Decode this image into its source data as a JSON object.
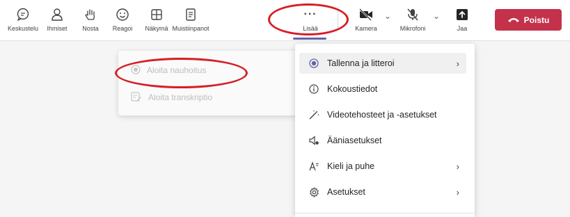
{
  "toolbar": {
    "chat_label": "Keskustelu",
    "people_label": "Ihmiset",
    "raise_label": "Nosta",
    "react_label": "Reagoi",
    "view_label": "Näkymä",
    "notes_label": "Muistiinpanot",
    "more_label": "Lisää",
    "more_glyph": "···",
    "camera_label": "Kamera",
    "mic_label": "Mikrofoni",
    "share_label": "Jaa",
    "leave_label": "Poistu",
    "leave_color": "#c4314b",
    "accent_color": "#6264a7"
  },
  "submenu": {
    "items": [
      {
        "label": "Aloita nauhoitus",
        "icon": "record-icon",
        "enabled": false
      },
      {
        "label": "Aloita transkriptio",
        "icon": "transcript-icon",
        "enabled": false
      }
    ]
  },
  "menu": {
    "items": [
      {
        "label": "Tallenna ja litteroi",
        "icon": "record-dot-icon",
        "has_submenu": true,
        "highlighted": true
      },
      {
        "label": "Kokoustiedot",
        "icon": "info-icon",
        "has_submenu": false
      },
      {
        "label": "Videotehosteet ja -asetukset",
        "icon": "magic-wand-icon",
        "has_submenu": false
      },
      {
        "label": "Ääniasetukset",
        "icon": "speaker-settings-icon",
        "has_submenu": false
      },
      {
        "label": "Kieli ja puhe",
        "icon": "language-icon",
        "has_submenu": true
      },
      {
        "label": "Asetukset",
        "icon": "gear-icon",
        "has_submenu": true
      }
    ]
  },
  "annotation_color": "#d61f26"
}
